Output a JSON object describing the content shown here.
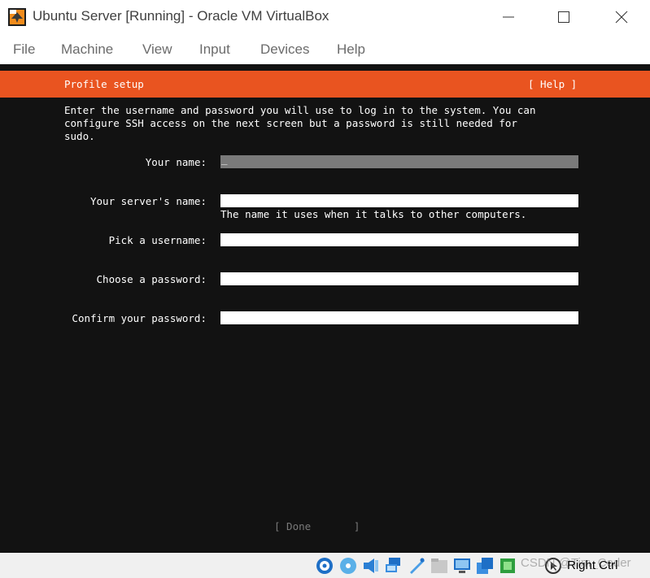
{
  "window": {
    "title": "Ubuntu Server [Running] - Oracle VM VirtualBox"
  },
  "menu": {
    "file": "File",
    "machine": "Machine",
    "view": "View",
    "input": "Input",
    "devices": "Devices",
    "help": "Help"
  },
  "installer": {
    "title": "Profile setup",
    "help": "[ Help ]",
    "intro": "Enter the username and password you will use to log in to the system. You can\nconfigure SSH access on the next screen but a password is still needed for\nsudo.",
    "fields": {
      "name_label": "Your name:",
      "name_value": "_",
      "server_label": "Your server's name:",
      "server_hint": "The name it uses when it talks to other computers.",
      "username_label": "Pick a username:",
      "password_label": "Choose a password:",
      "confirm_label": "Confirm your password:"
    },
    "done": "[ Done       ]"
  },
  "statusbar": {
    "host_key": "Right Ctrl",
    "watermark": "CSDN @Tim_Coder",
    "icons": [
      "hard-disk-icon",
      "optical-drive-icon",
      "audio-icon",
      "network-icon",
      "usb-icon",
      "shared-folders-icon",
      "display-icon",
      "recording-icon",
      "cpu-icon",
      "mouse-integration-icon"
    ]
  },
  "colors": {
    "accent": "#e95420",
    "terminal_bg": "#121212",
    "focused_field": "#7a7a7a"
  }
}
